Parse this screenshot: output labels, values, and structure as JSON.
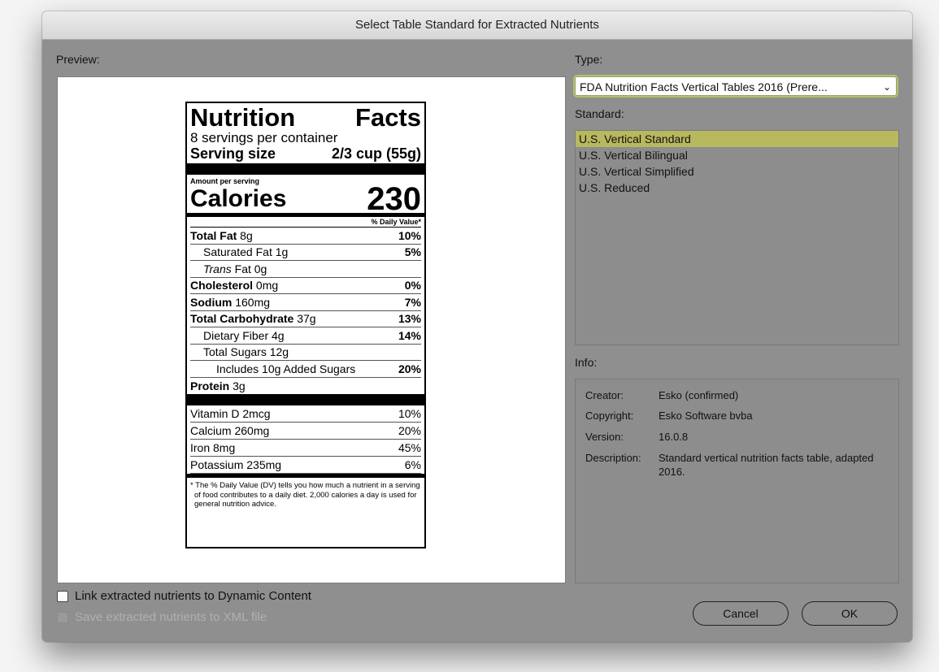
{
  "window": {
    "title": "Select Table Standard for Extracted Nutrients"
  },
  "preview": {
    "label": "Preview:",
    "nutrition": {
      "title_left": "Nutrition",
      "title_right": "Facts",
      "servings": "8 servings per container",
      "serving_size_label": "Serving size",
      "serving_size_value": "2/3 cup (55g)",
      "amount_per_serving": "Amount per serving",
      "calories_label": "Calories",
      "calories_value": "230",
      "dv_header": "% Daily Value*",
      "rows": [
        {
          "bold": "Total Fat",
          "text": " 8g",
          "pct": "10%"
        },
        {
          "bold": "",
          "text": "Saturated Fat 1g",
          "pct": "5%"
        },
        {
          "italic": "Trans",
          "text": " Fat 0g",
          "pct": ""
        },
        {
          "bold": "Cholesterol",
          "text": " 0mg",
          "pct": "0%"
        },
        {
          "bold": "Sodium",
          "text": " 160mg",
          "pct": "7%"
        },
        {
          "bold": "Total Carbohydrate",
          "text": " 37g",
          "pct": "13%"
        },
        {
          "bold": "",
          "text": "Dietary Fiber 4g",
          "pct": "14%"
        },
        {
          "bold": "",
          "text": "Total Sugars 12g",
          "pct": ""
        },
        {
          "bold": "",
          "text": "Includes 10g Added Sugars",
          "pct": "20%"
        },
        {
          "bold": "Protein",
          "text": " 3g",
          "pct": ""
        }
      ],
      "vitamins": [
        {
          "name": "Vitamin D 2mcg",
          "pct": "10%"
        },
        {
          "name": "Calcium 260mg",
          "pct": "20%"
        },
        {
          "name": "Iron 8mg",
          "pct": "45%"
        },
        {
          "name": "Potassium 235mg",
          "pct": "6%"
        }
      ],
      "footnote": "* The % Daily Value (DV) tells you how much a nutrient in a serving of food contributes to a daily diet. 2,000 calories a day is used for general nutrition advice."
    }
  },
  "type": {
    "label": "Type:",
    "selected": "FDA Nutrition Facts Vertical Tables 2016 (Prere..."
  },
  "standard": {
    "label": "Standard:",
    "items": [
      "U.S. Vertical Standard",
      "U.S. Vertical Bilingual",
      "U.S. Vertical Simplified",
      "U.S. Reduced"
    ],
    "selected_index": 0
  },
  "info": {
    "label": "Info:",
    "creator_key": "Creator:",
    "creator": "Esko (confirmed)",
    "copyright_key": "Copyright:",
    "copyright": "Esko Software bvba",
    "version_key": "Version:",
    "version": "16.0.8",
    "description_key": "Description:",
    "description": "Standard vertical nutrition facts table, adapted 2016."
  },
  "options": {
    "link_label": "Link extracted nutrients to Dynamic Content",
    "save_label": "Save extracted nutrients to XML file"
  },
  "buttons": {
    "cancel": "Cancel",
    "ok": "OK"
  }
}
